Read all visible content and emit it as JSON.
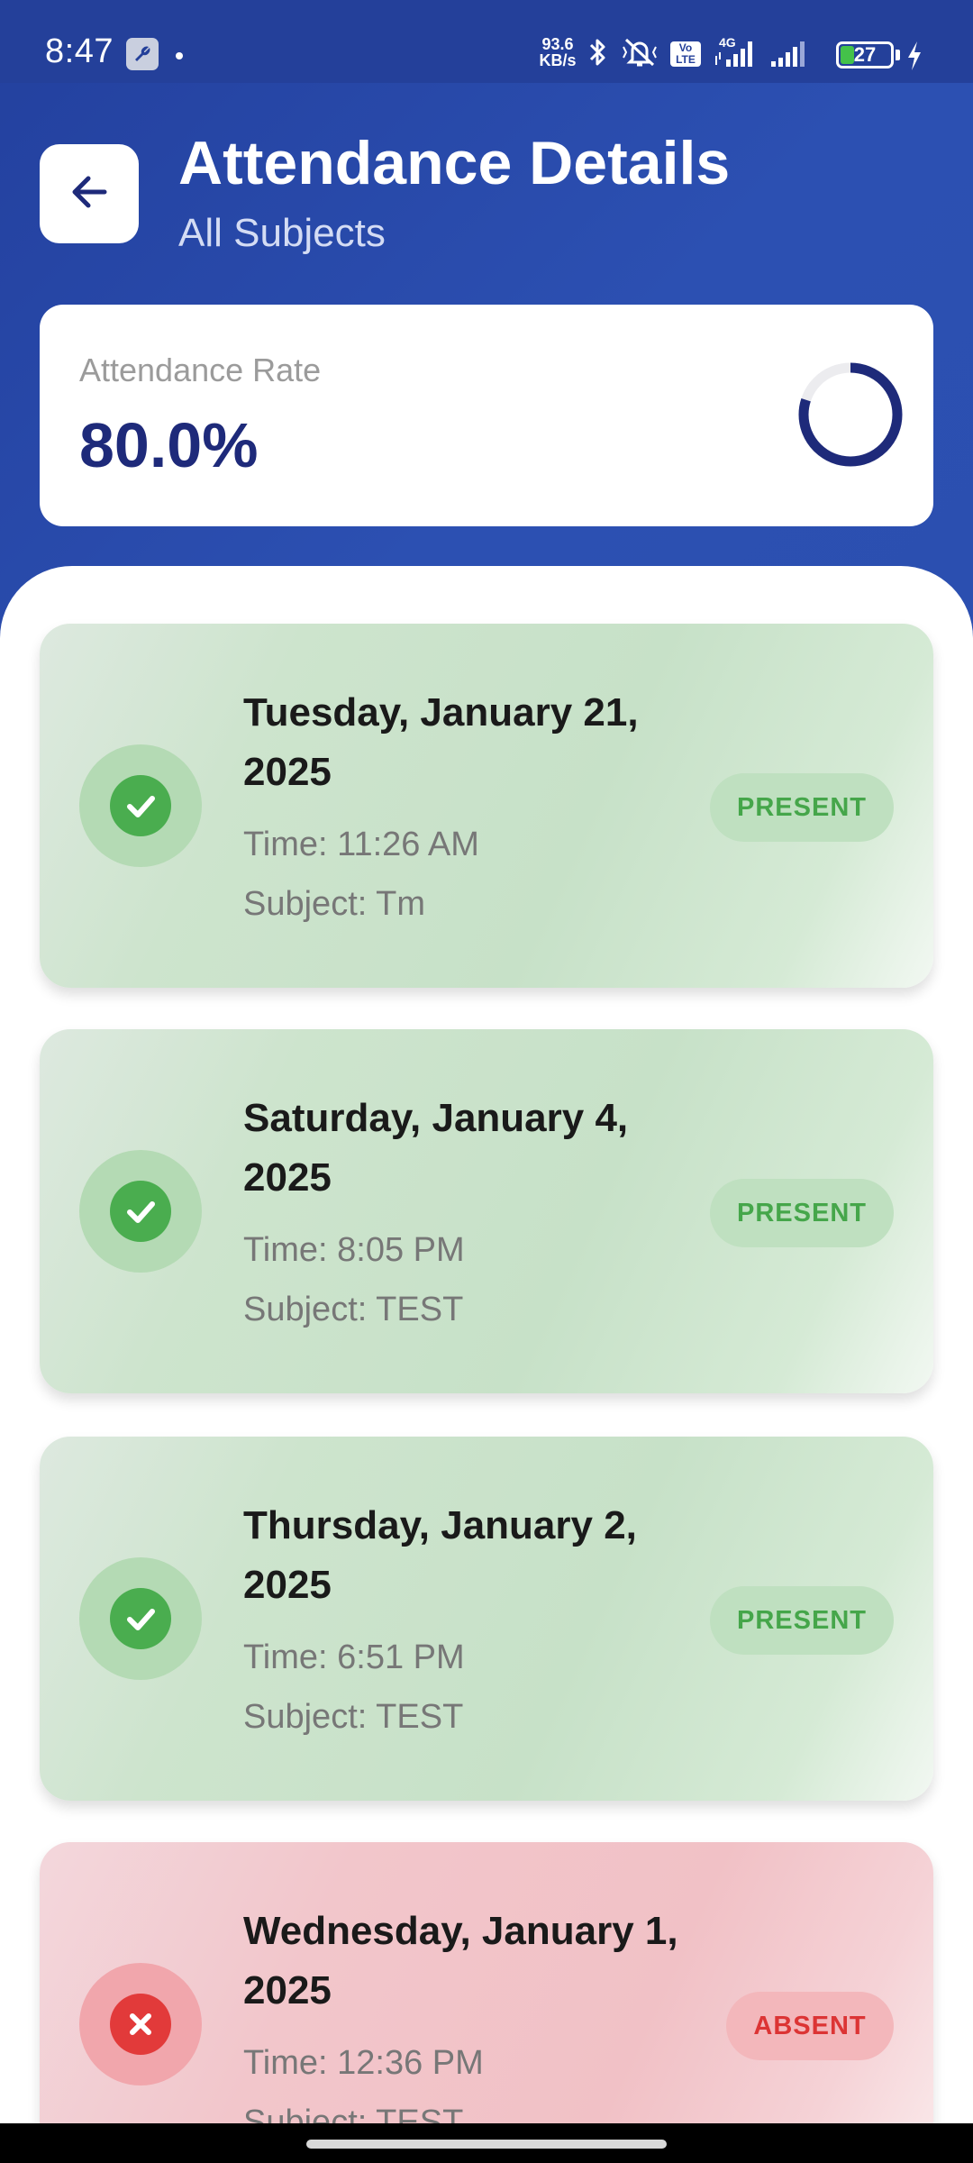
{
  "status_bar": {
    "time": "8:47",
    "net_speed_value": "93.6",
    "net_speed_unit": "KB/s",
    "volte_label": "Vo LTE",
    "network_type": "4G",
    "battery_level": 27,
    "battery_text": "27",
    "icons": [
      "wrench-icon",
      "bluetooth-icon",
      "mute-vibrate-icon",
      "volte-icon",
      "signal-icon",
      "signal-icon",
      "battery-icon",
      "charging-icon"
    ]
  },
  "header": {
    "title": "Attendance Details",
    "subtitle": "All Subjects",
    "back_icon": "arrow-left-icon"
  },
  "summary": {
    "label": "Attendance Rate",
    "value": "80.0%",
    "rate_fraction": 0.8,
    "ring_color": "#1e2a7a"
  },
  "records": [
    {
      "date": "Tuesday, January 21, 2025",
      "time": "Time: 11:26 AM",
      "subject": "Subject: Tm",
      "status": "PRESENT",
      "icon": "check-icon"
    },
    {
      "date": "Saturday, January 4, 2025",
      "time": "Time: 8:05 PM",
      "subject": "Subject: TEST",
      "status": "PRESENT",
      "icon": "check-icon"
    },
    {
      "date": "Thursday, January 2, 2025",
      "time": "Time: 6:51 PM",
      "subject": "Subject: TEST",
      "status": "PRESENT",
      "icon": "check-icon"
    },
    {
      "date": "Wednesday, January 1, 2025",
      "time": "Time: 12:36 PM",
      "subject": "Subject: TEST",
      "status": "ABSENT",
      "icon": "close-icon"
    }
  ],
  "colors": {
    "header_blue": "#2a4fae",
    "present_green": "#4aad4f",
    "absent_red": "#e23a3a",
    "title_navy": "#1e2a7a"
  }
}
